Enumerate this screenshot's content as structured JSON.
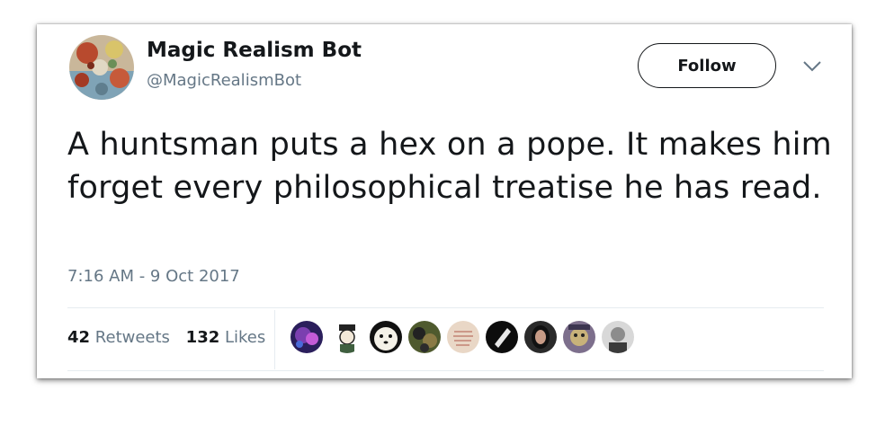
{
  "author": {
    "name": "Magic Realism Bot",
    "handle": "@MagicRealismBot"
  },
  "follow_label": "Follow",
  "tweet": {
    "text": "A huntsman puts a hex on a pope. It makes him forget every philosophical treatise he has read.",
    "timestamp": "7:16 AM - 9 Oct 2017"
  },
  "stats": {
    "retweets_count": "42",
    "retweets_label": "Retweets",
    "likes_count": "132",
    "likes_label": "Likes"
  },
  "icons": {
    "more": "chevron-down-icon"
  },
  "colors": {
    "text": "#14171a",
    "secondary": "#657786",
    "divider": "#e6ecf0"
  }
}
